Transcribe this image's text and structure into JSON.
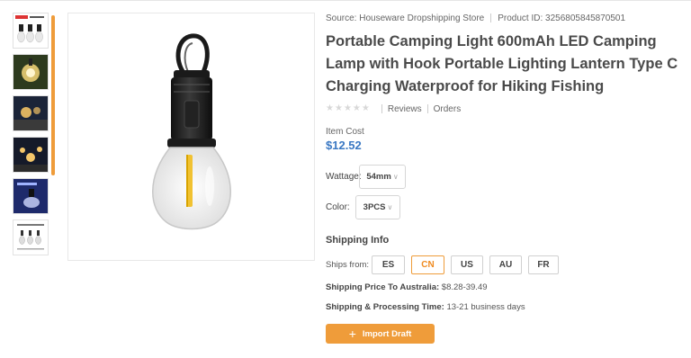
{
  "meta": {
    "source": "Source: Houseware Dropshipping Store",
    "product_id": "Product ID: 3256805845870501"
  },
  "product": {
    "title": "Portable Camping Light 600mAh LED Camping Lamp with Hook Portable Lighting Lantern Type C Charging Waterproof for Hiking Fishing",
    "rating": 0,
    "reviews_label": "Reviews",
    "orders_label": "Orders",
    "cost_label": "Item Cost",
    "cost": "$12.52"
  },
  "options": {
    "wattage_label": "Wattage:",
    "wattage_value": "54mm",
    "color_label": "Color:",
    "color_value": "3PCS"
  },
  "shipping": {
    "title": "Shipping Info",
    "ships_from_label": "Ships from:",
    "countries": [
      {
        "code": "ES",
        "selected": false
      },
      {
        "code": "CN",
        "selected": true
      },
      {
        "code": "US",
        "selected": false
      },
      {
        "code": "AU",
        "selected": false
      },
      {
        "code": "FR",
        "selected": false
      }
    ],
    "price_label": "Shipping Price To Australia:",
    "price_value": "$8.28-39.49",
    "time_label": "Shipping & Processing Time:",
    "time_value": "13-21 business days"
  },
  "actions": {
    "import_label": "Import Draft",
    "import_icon": "plus-icon"
  },
  "colors": {
    "accent": "#ef9c3a",
    "price": "#3a78c3"
  }
}
